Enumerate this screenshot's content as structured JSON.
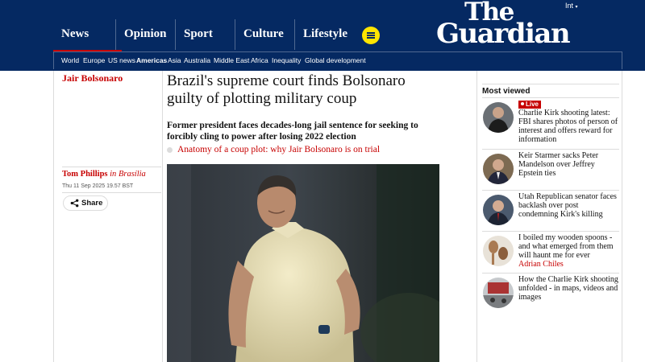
{
  "header": {
    "edition": "Int",
    "brand": {
      "line1": "The",
      "line2": "Guardian"
    },
    "pillars": [
      {
        "label": "News",
        "active": true
      },
      {
        "label": "Opinion"
      },
      {
        "label": "Sport"
      },
      {
        "label": "Culture"
      },
      {
        "label": "Lifestyle"
      }
    ],
    "subnav": [
      "World",
      "Europe",
      "US news",
      "Americas",
      "Asia",
      "Australia",
      "Middle East",
      "Africa",
      "Inequality",
      "Global development"
    ],
    "subnav_active": "Americas"
  },
  "article": {
    "tag": "Jair Bolsonaro",
    "headline": "Brazil's supreme court finds Bolsonaro guilty of plotting military coup",
    "standfirst": "Former president faces decades-long jail sentence for seeking to forcibly cling to power after losing 2022 election",
    "related_link": "Anatomy of a coup plot: why Jair Bolsonaro is on trial",
    "author": "Tom Phillips",
    "location_prefix": "in",
    "location": "Brasília",
    "date": "Thu 11 Sep 2025 19.57 BST",
    "share_label": "Share"
  },
  "most_viewed": {
    "title": "Most viewed",
    "items": [
      {
        "live_label": "Live",
        "text": "Charlie Kirk shooting latest: FBI shares photos of person of interest and offers reward for information"
      },
      {
        "text": "Keir Starmer sacks Peter Mandelson over Jeffrey Epstein ties"
      },
      {
        "text": "Utah Republican senator faces backlash over post condemning Kirk's killing"
      },
      {
        "text": "I boiled my wooden spoons - and what emerged from them will haunt me for ever",
        "author": "Adrian Chiles"
      },
      {
        "text": "How the Charlie Kirk shooting unfolded - in maps, videos and images"
      }
    ]
  },
  "colors": {
    "brand_blue": "#052962",
    "news_red": "#c70000",
    "menu_yellow": "#ffe500"
  }
}
